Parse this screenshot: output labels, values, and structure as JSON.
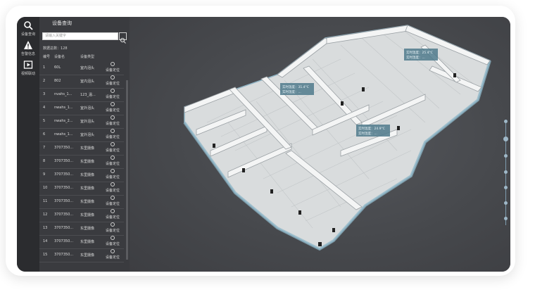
{
  "rail": [
    {
      "icon": "search-icon",
      "label": "设备查询"
    },
    {
      "icon": "warning-icon",
      "label": "告警信息"
    },
    {
      "icon": "video-icon",
      "label": "视频联动"
    }
  ],
  "panel": {
    "title": "设备查询",
    "search_placeholder": "请输入关键字",
    "count_label": "数据总数：",
    "count_value": "128",
    "columns": {
      "index": "编号",
      "name": "设备名",
      "location": "设备类型"
    }
  },
  "rows": [
    {
      "index": "1",
      "name": "60L",
      "type": "室内泪头"
    },
    {
      "index": "2",
      "name": "802",
      "type": "室内泪头"
    },
    {
      "index": "3",
      "name": "nvahs_1...",
      "type": "123_温..."
    },
    {
      "index": "4",
      "name": "nwahs_1...",
      "type": "室外泪头"
    },
    {
      "index": "5",
      "name": "nwahs_2...",
      "type": "室外泪头"
    },
    {
      "index": "6",
      "name": "nwahs_1...",
      "type": "室外泪头"
    },
    {
      "index": "7",
      "name": "3707350...",
      "type": "东里摄像"
    },
    {
      "index": "8",
      "name": "3707350...",
      "type": "东里摄像"
    },
    {
      "index": "9",
      "name": "3707350...",
      "type": "东里摄像"
    },
    {
      "index": "10",
      "name": "3707350...",
      "type": "东里摄像"
    },
    {
      "index": "11",
      "name": "3707350...",
      "type": "东里摄像"
    },
    {
      "index": "12",
      "name": "3707350...",
      "type": "东里摄像"
    },
    {
      "index": "13",
      "name": "3707350...",
      "type": "东里摄像"
    },
    {
      "index": "14",
      "name": "3707350...",
      "type": "东里摄像"
    },
    {
      "index": "15",
      "name": "3707350...",
      "type": "东里摄像"
    }
  ],
  "locate_label": "设备定位",
  "map_tags": [
    {
      "line1": "实时温度：31.4°C",
      "line2": "实时湿度：..."
    },
    {
      "line1": "实时温度：25.4°C",
      "line2": "实时湿度：..."
    },
    {
      "line1": "实时温度：24.9°C",
      "line2": "实时湿度：..."
    }
  ]
}
